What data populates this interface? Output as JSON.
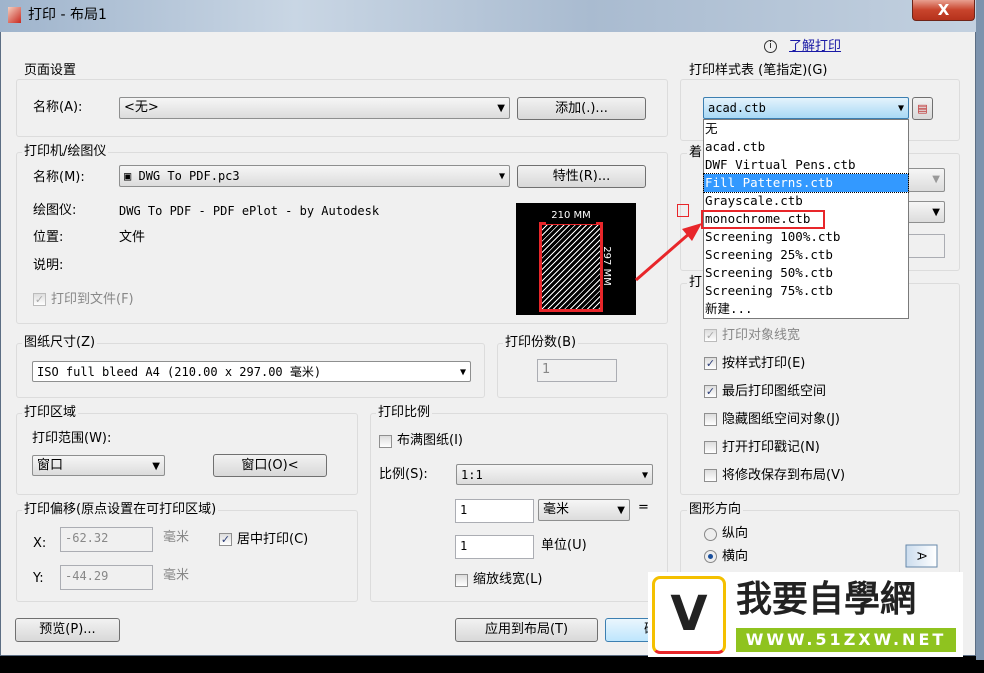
{
  "window": {
    "title": "打印 - 布局1",
    "close": "X",
    "help_link": "了解打印",
    "help_icon": "info-icon"
  },
  "page_setup": {
    "group": "页面设置",
    "name_label": "名称(A):",
    "name_value": "<无>",
    "add_button": "添加(.)..."
  },
  "plotter": {
    "group": "打印机/绘图仪",
    "name_label": "名称(M):",
    "name_value": "DWG To PDF.pc3",
    "properties_button": "特性(R)...",
    "plotter_label": "绘图仪:",
    "plotter_value": "DWG To PDF - PDF ePlot - by Autodesk",
    "location_label": "位置:",
    "location_value": "文件",
    "description_label": "说明:",
    "plot_to_file": "打印到文件(F)",
    "plot_to_file_checked": true,
    "preview_width": "210 MM",
    "preview_height": "297 MM"
  },
  "paper_size": {
    "group": "图纸尺寸(Z)",
    "value": "ISO full bleed A4 (210.00 x 297.00 毫米)"
  },
  "copies": {
    "group": "打印份数(B)",
    "value": "1"
  },
  "plot_area": {
    "group": "打印区域",
    "what_label": "打印范围(W):",
    "what_value": "窗口",
    "window_button": "窗口(O)<"
  },
  "plot_offset": {
    "group": "打印偏移(原点设置在可打印区域)",
    "x_label": "X:",
    "x_value": "-62.32",
    "y_label": "Y:",
    "y_value": "-44.29",
    "unit": "毫米",
    "center": "居中打印(C)",
    "center_checked": true
  },
  "plot_scale": {
    "group": "打印比例",
    "fit": "布满图纸(I)",
    "fit_checked": false,
    "scale_label": "比例(S):",
    "scale_value": "1:1",
    "value1": "1",
    "unit1": "毫米",
    "equals": "=",
    "value2": "1",
    "unit2": "单位(U)",
    "scale_lineweights": "缩放线宽(L)",
    "scale_lineweights_checked": false
  },
  "style_table": {
    "group": "打印样式表 (笔指定)(G)",
    "value": "acad.ctb",
    "edit_icon": "edit-style-icon",
    "options": [
      "无",
      "acad.ctb",
      "DWF Virtual Pens.ctb",
      "Fill Patterns.ctb",
      "Grayscale.ctb",
      "monochrome.ctb",
      "Screening 100%.ctb",
      "Screening 25%.ctb",
      "Screening 50%.ctb",
      "Screening 75%.ctb",
      "新建..."
    ],
    "highlighted": "Fill Patterns.ctb",
    "boxed": "monochrome.ctb"
  },
  "shaded_group_partial": "着",
  "options_group_partial": "打",
  "plot_options": [
    {
      "label": "打印对象线宽",
      "checked": true,
      "disabled": true
    },
    {
      "label": "按样式打印(E)",
      "checked": true
    },
    {
      "label": "最后打印图纸空间",
      "checked": true
    },
    {
      "label": "隐藏图纸空间对象(J)",
      "checked": false
    },
    {
      "label": "打开打印戳记(N)",
      "checked": false
    },
    {
      "label": "将修改保存到布局(V)",
      "checked": false
    }
  ],
  "orientation": {
    "group": "图形方向",
    "portrait": "纵向",
    "landscape": "横向",
    "selected": "横向",
    "paper_icon_letter": "A"
  },
  "buttons": {
    "preview": "预览(P)...",
    "apply": "应用到布局(T)",
    "ok": "确定"
  },
  "watermark": {
    "text": "我要自學網",
    "url": "WWW.51ZXW.NET"
  },
  "colors": {
    "highlight": "#3399ff",
    "annotation": "#e8262a",
    "link": "#1a1aa6"
  }
}
